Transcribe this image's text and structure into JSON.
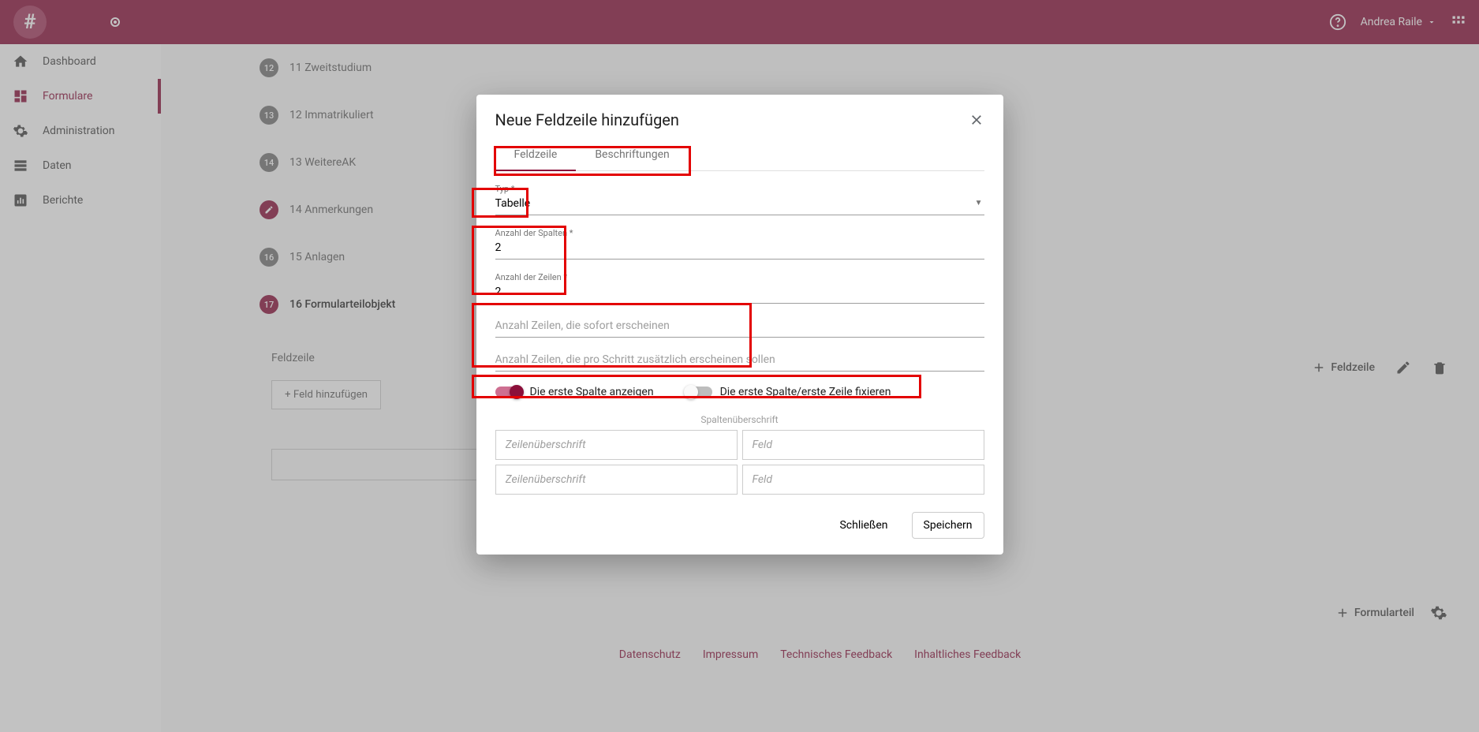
{
  "header": {
    "user_name": "Andrea Raile"
  },
  "nav": {
    "items": [
      "Dashboard",
      "Formulare",
      "Administration",
      "Daten",
      "Berichte"
    ]
  },
  "steps": [
    {
      "num": "12",
      "label": "11 Zweitstudium"
    },
    {
      "num": "13",
      "label": "12 Immatrikuliert"
    },
    {
      "num": "14",
      "label": "13 WeitereAK"
    },
    {
      "num": "✎",
      "label": "14 Anmerkungen"
    },
    {
      "num": "16",
      "label": "15 Anlagen"
    },
    {
      "num": "17",
      "label": "16 Formularteilobjekt"
    }
  ],
  "toolbar": {
    "feldzeile": "Feldzeile",
    "section_title": "Feldzeile",
    "add_field": "+ Feld hinzufügen",
    "add_part": "Formularteil"
  },
  "footer": {
    "links": [
      "Datenschutz",
      "Impressum",
      "Technisches Feedback",
      "Inhaltliches Feedback"
    ]
  },
  "dialog": {
    "title": "Neue Feldzeile hinzufügen",
    "tabs": {
      "feldzeile": "Feldzeile",
      "beschriftungen": "Beschriftungen"
    },
    "typ_label": "Typ *",
    "typ_value": "Tabelle",
    "spalten_label": "Anzahl der Spalten *",
    "spalten_value": "2",
    "zeilen_label": "Anzahl der Zeilen *",
    "zeilen_value": "2",
    "sofort_placeholder": "Anzahl Zeilen, die sofort erscheinen",
    "schritt_placeholder": "Anzahl Zeilen, die pro Schritt zusätzlich erscheinen sollen",
    "toggle1": "Die erste Spalte anzeigen",
    "toggle2": "Die erste Spalte/erste Zeile fixieren",
    "col_header": "Spaltenüberschrift",
    "row_ph": "Zeilenüberschrift",
    "field_ph": "Feld",
    "close": "Schließen",
    "save": "Speichern"
  }
}
